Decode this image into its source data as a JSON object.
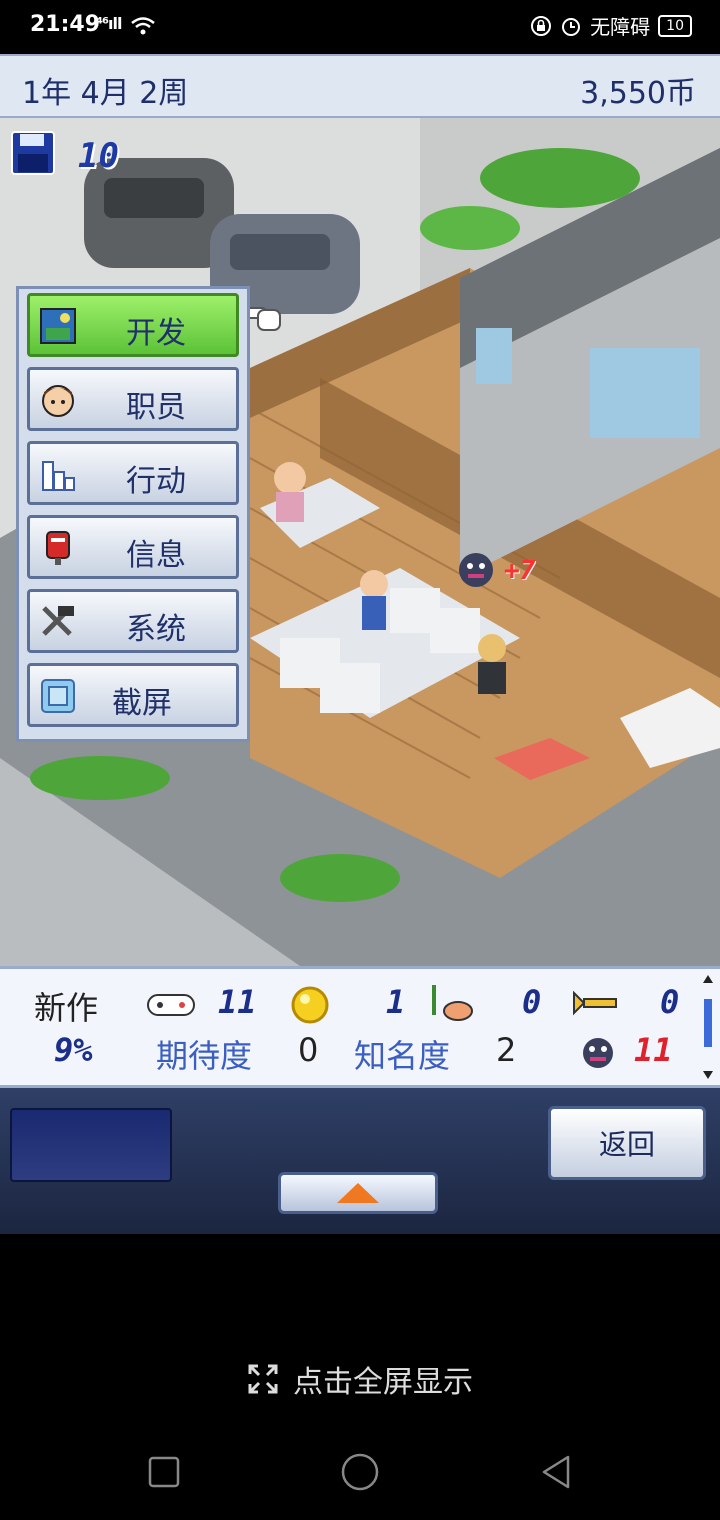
{
  "status_bar": {
    "time": "21:49",
    "signal": "⁴⁶ıll",
    "accessibility": "无障碍",
    "battery": "10"
  },
  "top_bar": {
    "date": "1年 4月 2周",
    "money": "3,550币"
  },
  "scene": {
    "save_count": "10",
    "bonus": "+7"
  },
  "menu": {
    "items": [
      {
        "label": "开发",
        "icon": "painting-icon",
        "active": true
      },
      {
        "label": "职员",
        "icon": "staff-face-icon",
        "active": false
      },
      {
        "label": "行动",
        "icon": "buildings-icon",
        "active": false
      },
      {
        "label": "信息",
        "icon": "mailbox-icon",
        "active": false
      },
      {
        "label": "系统",
        "icon": "tools-icon",
        "active": false
      },
      {
        "label": "截屏",
        "icon": "camera-icon",
        "active": false
      }
    ]
  },
  "info_panel": {
    "new_title_label": "新作",
    "progress": "9%",
    "fun_value": "11",
    "creativity_value": "1",
    "graphics_value": "0",
    "sound_value": "0",
    "expectation_label": "期待度",
    "expectation_value": "0",
    "fame_label": "知名度",
    "fame_value": "2",
    "bug_value": "11"
  },
  "controls": {
    "back_label": "返回"
  },
  "fullscreen_hint": "点击全屏显示",
  "colors": {
    "accent_blue": "#1f2f6a",
    "menu_active": "#5cc238",
    "bug_red": "#e0202a"
  }
}
